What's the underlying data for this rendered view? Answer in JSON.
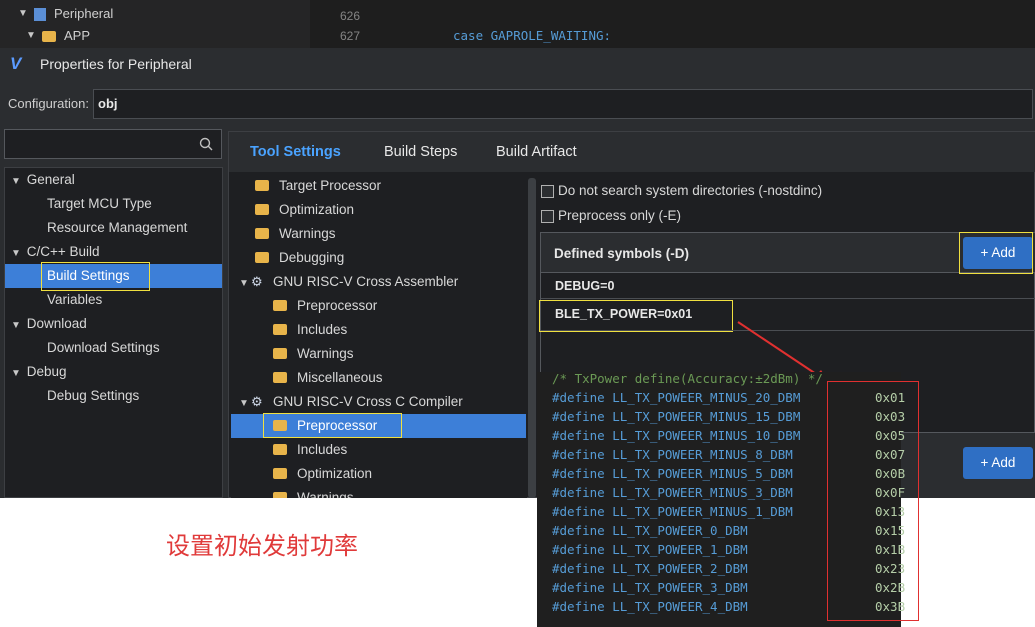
{
  "explorer": {
    "items": [
      {
        "label": "Peripheral",
        "icon": "project-icon"
      },
      {
        "label": "APP",
        "icon": "folder-icon"
      }
    ]
  },
  "editor": {
    "line_numbers": [
      "626",
      "627"
    ],
    "code_line": "case GAPROLE_WAITING:"
  },
  "window": {
    "title": "Properties for Peripheral"
  },
  "config": {
    "label": "Configuration:",
    "value": "obj"
  },
  "left_tree": [
    {
      "label": "General",
      "level": 0,
      "expanded": true
    },
    {
      "label": "Target MCU Type",
      "level": 1
    },
    {
      "label": "Resource Management",
      "level": 1
    },
    {
      "label": "C/C++ Build",
      "level": 0,
      "expanded": true
    },
    {
      "label": "Build Settings",
      "level": 1,
      "selected": true
    },
    {
      "label": "Variables",
      "level": 1
    },
    {
      "label": "Download",
      "level": 0,
      "expanded": true
    },
    {
      "label": "Download Settings",
      "level": 1
    },
    {
      "label": "Debug",
      "level": 0,
      "expanded": true
    },
    {
      "label": "Debug Settings",
      "level": 1
    }
  ],
  "tabs": [
    "Tool Settings",
    "Build Steps",
    "Build Artifact"
  ],
  "tool_tree": [
    {
      "label": "Target Processor",
      "level": 1,
      "icon": "folder"
    },
    {
      "label": "Optimization",
      "level": 1,
      "icon": "folder"
    },
    {
      "label": "Warnings",
      "level": 1,
      "icon": "folder"
    },
    {
      "label": "Debugging",
      "level": 1,
      "icon": "folder"
    },
    {
      "label": "GNU RISC-V Cross Assembler",
      "level": 0,
      "icon": "gear"
    },
    {
      "label": "Preprocessor",
      "level": 2,
      "icon": "folder"
    },
    {
      "label": "Includes",
      "level": 2,
      "icon": "folder"
    },
    {
      "label": "Warnings",
      "level": 2,
      "icon": "folder"
    },
    {
      "label": "Miscellaneous",
      "level": 2,
      "icon": "folder"
    },
    {
      "label": "GNU RISC-V Cross C Compiler",
      "level": 0,
      "icon": "gear"
    },
    {
      "label": "Preprocessor",
      "level": 2,
      "icon": "folder",
      "selected": true
    },
    {
      "label": "Includes",
      "level": 2,
      "icon": "folder"
    },
    {
      "label": "Optimization",
      "level": 2,
      "icon": "folder"
    },
    {
      "label": "Warnings",
      "level": 2,
      "icon": "folder"
    }
  ],
  "options": [
    {
      "label": "Do not search system directories (-nostdinc)",
      "checked": false
    },
    {
      "label": "Preprocess only (-E)",
      "checked": false
    }
  ],
  "symbols": {
    "header": "Defined symbols (-D)",
    "add_label": "+ Add",
    "items": [
      "DEBUG=0",
      "BLE_TX_POWER=0x01"
    ]
  },
  "code_popup": {
    "comment": "/* TxPower define(Accuracy:±2dBm) */",
    "defines": [
      {
        "name": "#define LL_TX_POWEER_MINUS_20_DBM",
        "value": "0x01"
      },
      {
        "name": "#define LL_TX_POWEER_MINUS_15_DBM",
        "value": "0x03"
      },
      {
        "name": "#define LL_TX_POWEER_MINUS_10_DBM",
        "value": "0x05"
      },
      {
        "name": "#define LL_TX_POWEER_MINUS_8_DBM",
        "value": "0x07"
      },
      {
        "name": "#define LL_TX_POWEER_MINUS_5_DBM",
        "value": "0x0B"
      },
      {
        "name": "#define LL_TX_POWEER_MINUS_3_DBM",
        "value": "0x0F"
      },
      {
        "name": "#define LL_TX_POWEER_MINUS_1_DBM",
        "value": "0x13"
      },
      {
        "name": "#define LL_TX_POWEER_0_DBM",
        "value": "0x15"
      },
      {
        "name": "#define LL_TX_POWEER_1_DBM",
        "value": "0x1B"
      },
      {
        "name": "#define LL_TX_POWEER_2_DBM",
        "value": "0x23"
      },
      {
        "name": "#define LL_TX_POWEER_3_DBM",
        "value": "0x2B"
      },
      {
        "name": "#define LL_TX_POWEER_4_DBM",
        "value": "0x3B"
      }
    ]
  },
  "caption": "设置初始发射功率",
  "colors": {
    "accent": "#4aa3ff",
    "highlight": "#f0e040",
    "annotation": "#e03030"
  }
}
